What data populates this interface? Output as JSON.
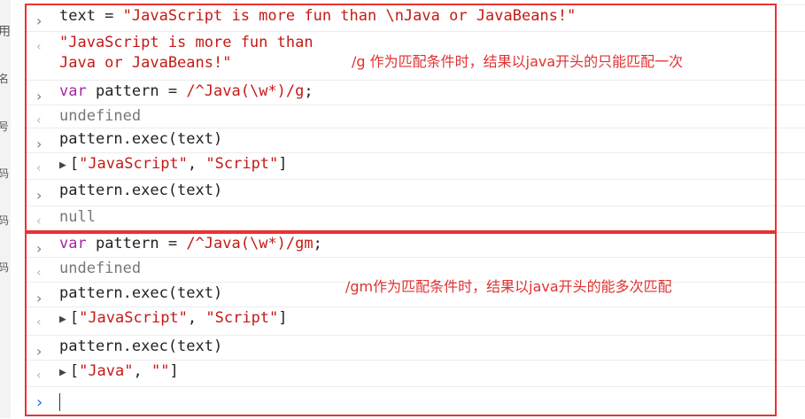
{
  "left_panel_chars": [
    "用",
    "名",
    "号",
    "码",
    "码",
    "码"
  ],
  "entries": [
    {
      "kind": "input",
      "parts": [
        {
          "t": "text = "
        },
        {
          "t": "\"JavaScript is more fun than \\nJava or JavaBeans!\"",
          "c": "str"
        }
      ]
    },
    {
      "kind": "output",
      "lines": [
        "\"JavaScript is more fun than",
        "Java or JavaBeans!\""
      ]
    },
    {
      "kind": "input",
      "parts": [
        {
          "t": "var",
          "c": "kw"
        },
        {
          "t": " pattern = "
        },
        {
          "t": "/^Java(\\w*)/g",
          "c": "regex"
        },
        {
          "t": ";"
        }
      ]
    },
    {
      "kind": "output",
      "text": "undefined"
    },
    {
      "kind": "input",
      "text": "pattern.exec(text)"
    },
    {
      "kind": "output",
      "array": [
        "\"JavaScript\"",
        "\"Script\""
      ]
    },
    {
      "kind": "input",
      "text": "pattern.exec(text)"
    },
    {
      "kind": "output",
      "text": "null"
    },
    {
      "kind": "input",
      "parts": [
        {
          "t": "var",
          "c": "kw"
        },
        {
          "t": " pattern = "
        },
        {
          "t": "/^Java(\\w*)/gm",
          "c": "regex"
        },
        {
          "t": ";"
        }
      ]
    },
    {
      "kind": "output",
      "text": "undefined"
    },
    {
      "kind": "input",
      "text": "pattern.exec(text)"
    },
    {
      "kind": "output",
      "array": [
        "\"JavaScript\"",
        "\"Script\""
      ]
    },
    {
      "kind": "input",
      "text": "pattern.exec(text)"
    },
    {
      "kind": "output",
      "array": [
        "\"Java\"",
        "\"\""
      ]
    }
  ],
  "annotations": {
    "g_note": "/g 作为匹配条件时，结果以java开头的只能匹配一次",
    "gm_note": "/gm作为匹配条件时，结果以java开头的能多次匹配"
  },
  "icons": {
    "input": "›",
    "output": "‹",
    "expand": "▶",
    "active": "›"
  },
  "colors": {
    "annotation": "#e03131",
    "box": "#ea3232",
    "string": "#c41a16",
    "keyword": "#a626a4"
  }
}
